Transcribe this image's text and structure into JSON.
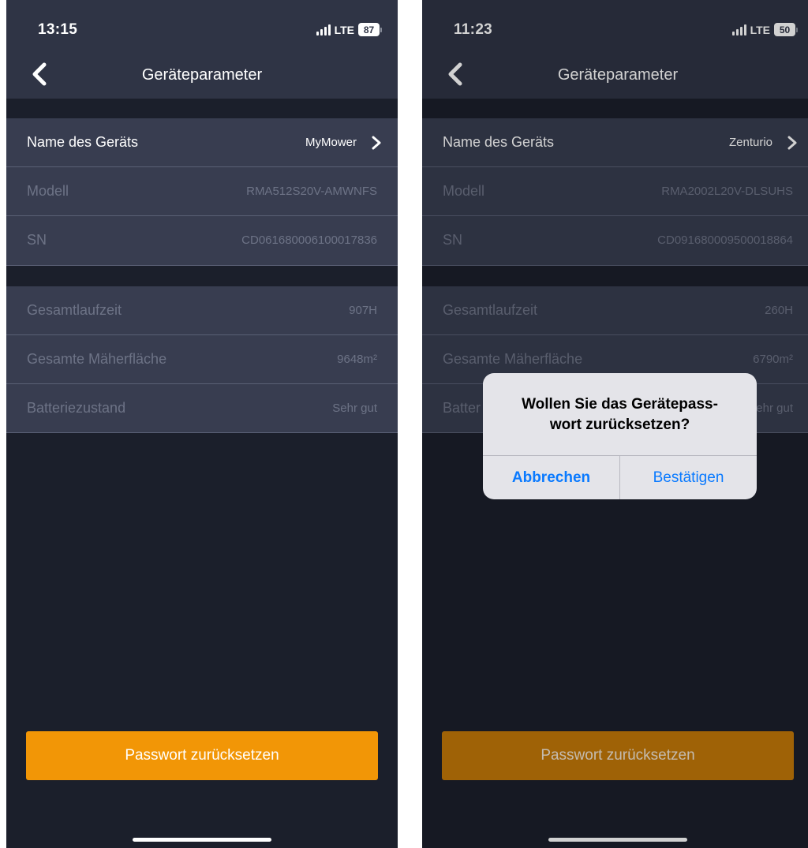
{
  "screens": [
    {
      "status": {
        "time": "13:15",
        "network": "LTE",
        "battery": "87"
      },
      "nav": {
        "title": "Geräteparameter"
      },
      "rows": [
        {
          "label": "Name des Geräts",
          "value": "MyMower"
        },
        {
          "label": "Modell",
          "value": "RMA512S20V-AMWNFS"
        },
        {
          "label": "SN",
          "value": "CD061680006100017836"
        },
        {
          "label": "Gesamtlaufzeit",
          "value": "907H"
        },
        {
          "label": "Gesamte Mäherfläche",
          "value": "9648m²"
        },
        {
          "label": "Batteriezustand",
          "value": "Sehr gut"
        }
      ],
      "reset_button": "Passwort zurücksetzen"
    },
    {
      "status": {
        "time": "11:23",
        "network": "LTE",
        "battery": "50"
      },
      "nav": {
        "title": "Geräteparameter"
      },
      "rows": [
        {
          "label": "Name des Geräts",
          "value": "Zenturio"
        },
        {
          "label": "Modell",
          "value": "RMA2002L20V-DLSUHS"
        },
        {
          "label": "SN",
          "value": "CD091680009500018864"
        },
        {
          "label": "Gesamtlaufzeit",
          "value": "260H"
        },
        {
          "label": "Gesamte Mäherfläche",
          "value": "6790m²"
        },
        {
          "label": "Batter",
          "value": "ehr gut"
        }
      ],
      "reset_button": "Passwort zurücksetzen",
      "alert": {
        "title_line1": "Wollen Sie das Gerätepass-",
        "title_line2": "wort zurücksetzen?",
        "cancel": "Abbrechen",
        "confirm": "Bestätigen"
      }
    }
  ],
  "colors": {
    "accent_orange": "#f29606",
    "alert_button_blue": "#0a7aff",
    "background": "#1b1f2b",
    "row_background": "#383d50",
    "header_background": "#2f3445"
  },
  "icons": {
    "back": "chevron-left-icon",
    "row_disclosure": "chevron-right-icon",
    "signal": "cellular-signal-icon",
    "battery": "battery-icon"
  }
}
